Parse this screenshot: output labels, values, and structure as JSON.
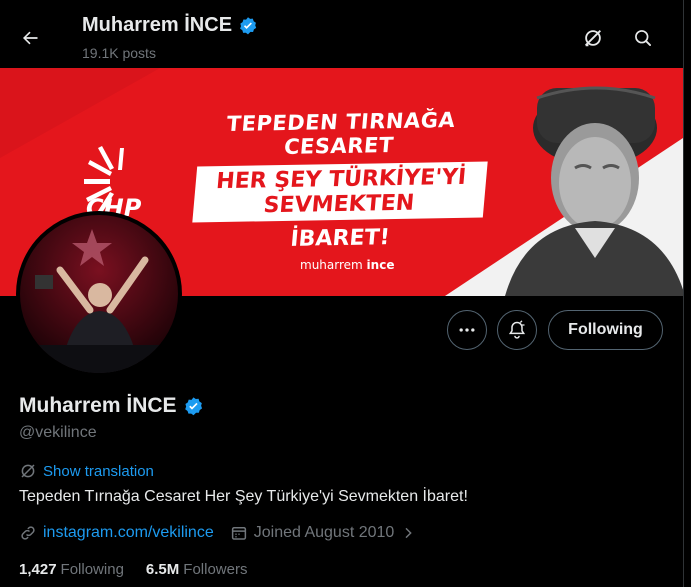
{
  "header": {
    "name": "Muharrem İNCE",
    "posts": "19.1K posts"
  },
  "banner": {
    "line1": "TEPEDEN TIRNAĞA CESARET",
    "line2": "HER ŞEY TÜRKİYE'Yİ SEVMEKTEN",
    "line3": "İBARET!",
    "brand_first": "muharrem ",
    "brand_second": "ince",
    "party": "CHP"
  },
  "actions": {
    "following_label": "Following"
  },
  "profile": {
    "name": "Muharrem İNCE",
    "handle": "@vekilince",
    "translate_label": "Show translation",
    "bio": "Tepeden Tırnağa Cesaret Her Şey Türkiye'yi Sevmekten İbaret!",
    "link": "instagram.com/vekilince",
    "joined": "Joined August 2010",
    "following_count": "1,427",
    "following_label": "Following",
    "followers_count": "6.5M",
    "followers_label": "Followers"
  },
  "colors": {
    "accent": "#1d9bf0",
    "banner_red": "#e4161c",
    "muted": "#71767b"
  },
  "icons": [
    "back-arrow-icon",
    "grok-icon",
    "search-icon",
    "more-icon",
    "notification-bell-icon",
    "verified-badge-icon",
    "translate-icon",
    "link-icon",
    "calendar-icon",
    "chevron-right-icon"
  ]
}
